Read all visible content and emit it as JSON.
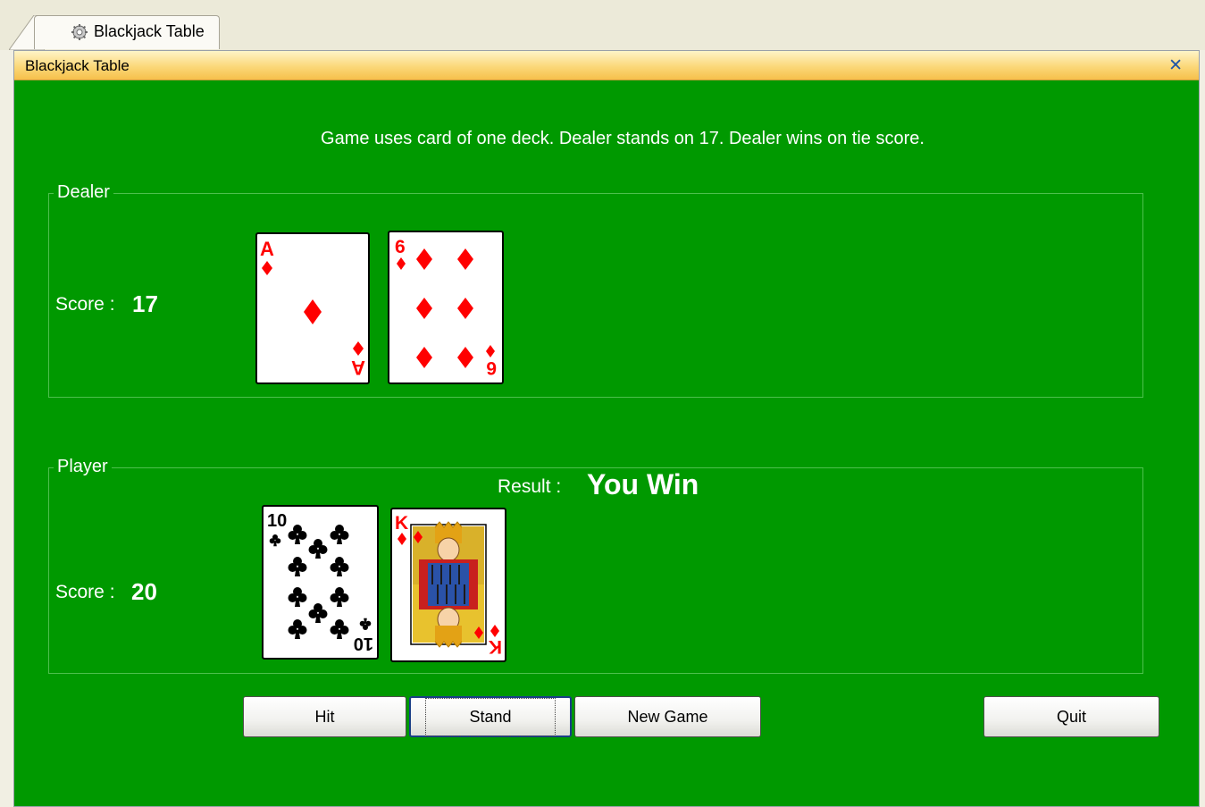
{
  "tab": {
    "label": "Blackjack Table"
  },
  "window": {
    "title": "Blackjack Table",
    "close_glyph": "✕"
  },
  "rules_text": "Game uses card of one deck. Dealer stands on 17. Dealer wins on tie score.",
  "dealer": {
    "legend": "Dealer",
    "score_label": "Score :",
    "score": "17",
    "cards": [
      {
        "rank": "A",
        "suit": "diamonds"
      },
      {
        "rank": "6",
        "suit": "diamonds"
      }
    ]
  },
  "result": {
    "label": "Result :",
    "value": "You Win"
  },
  "player": {
    "legend": "Player",
    "score_label": "Score :",
    "score": "20",
    "cards": [
      {
        "rank": "10",
        "suit": "clubs"
      },
      {
        "rank": "K",
        "suit": "diamonds"
      }
    ]
  },
  "buttons": {
    "hit": "Hit",
    "stand": "Stand",
    "new_game": "New Game",
    "quit": "Quit"
  },
  "colors": {
    "felt": "#009900",
    "red_suit": "#ff0000",
    "black_suit": "#000000"
  },
  "icons": {
    "tab": "gear-icon",
    "close": "close-icon"
  }
}
